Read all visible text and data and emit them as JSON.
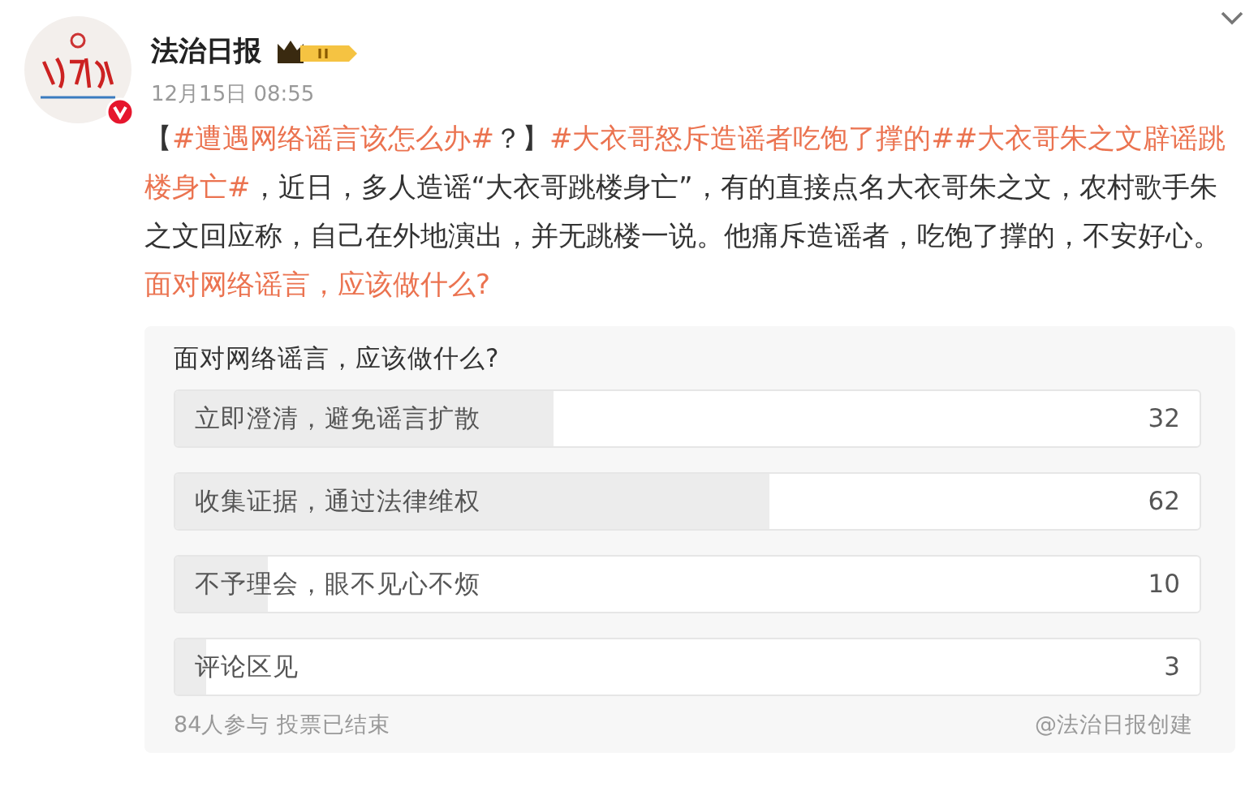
{
  "author": {
    "name": "法治日报",
    "time": "12月15日 08:55",
    "verified": true
  },
  "post": [
    {
      "kind": "plain",
      "text": "【"
    },
    {
      "kind": "link",
      "text": "#遭遇网络谣言该怎么办#"
    },
    {
      "kind": "plain",
      "text": "？】"
    },
    {
      "kind": "link",
      "text": "#大衣哥怒斥造谣者吃饱了撑的#"
    },
    {
      "kind": "link",
      "text": "#大衣哥朱之文辟谣跳楼身亡#"
    },
    {
      "kind": "plain",
      "text": "，近日，多人造谣“大衣哥跳楼身亡”，有的直接点名大衣哥朱之文，农村歌手朱之文回应称，自己在外地演出，并无跳楼一说。他痛斥造谣者，吃饱了撑的，不安好心。 "
    },
    {
      "kind": "link",
      "text": "面对网络谣言，应该做什么?"
    }
  ],
  "poll": {
    "question": "面对网络谣言，应该做什么?",
    "options": [
      {
        "label": "立即澄清，避免谣言扩散",
        "count": "32",
        "level": 0.37
      },
      {
        "label": "收集证据，通过法律维权",
        "count": "62",
        "level": 0.58
      },
      {
        "label": "不予理会，眼不见心不烦",
        "count": "10",
        "level": 0.09
      },
      {
        "label": "评论区见",
        "count": "3",
        "level": 0.03
      }
    ],
    "summary": "84人参与 投票已结束",
    "creator": "@法治日报创建"
  }
}
